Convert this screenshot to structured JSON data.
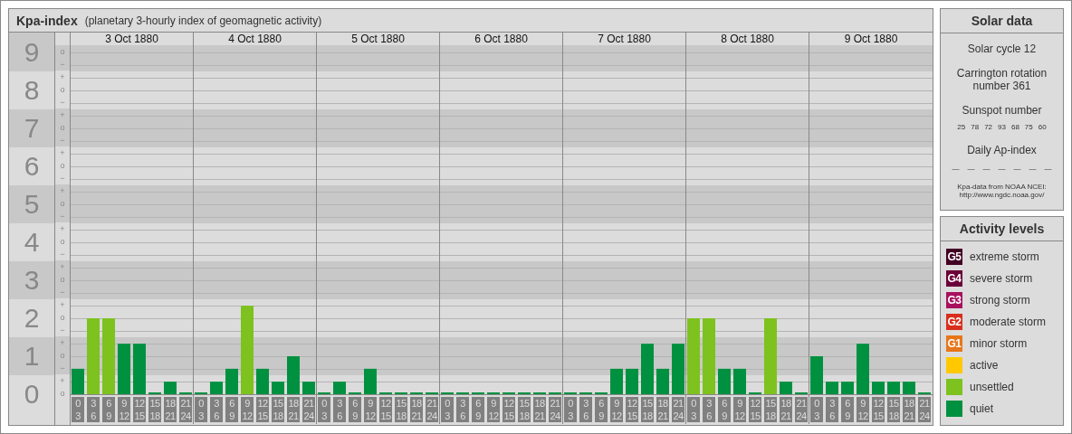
{
  "kpa_panel": {
    "title": "Kpa-index",
    "subtitle": "(planetary 3-hourly index of geomagnetic activity)",
    "y_marks": [
      [
        "o",
        "−"
      ],
      [
        "+",
        "o",
        "−"
      ],
      [
        "+",
        "o",
        "−"
      ],
      [
        "+",
        "o",
        "−"
      ],
      [
        "+",
        "o",
        "−"
      ],
      [
        "+",
        "o",
        "−"
      ],
      [
        "+",
        "o",
        "−"
      ],
      [
        "+",
        "o",
        "−"
      ],
      [
        "+",
        "o",
        "−"
      ],
      [
        "+",
        "o"
      ]
    ],
    "days": [
      {
        "date": "3 Oct 1880",
        "slots": [
          [
            "0",
            "3"
          ],
          [
            "3",
            "6"
          ],
          [
            "6",
            "9"
          ],
          [
            "9",
            "12"
          ],
          [
            "12",
            "15"
          ],
          [
            "15",
            "18"
          ],
          [
            "18",
            "21"
          ],
          [
            "21",
            "24"
          ]
        ]
      },
      {
        "date": "4 Oct 1880",
        "slots": [
          [
            "0",
            "3"
          ],
          [
            "3",
            "6"
          ],
          [
            "6",
            "9"
          ],
          [
            "9",
            "12"
          ],
          [
            "12",
            "15"
          ],
          [
            "15",
            "18"
          ],
          [
            "18",
            "21"
          ],
          [
            "21",
            "24"
          ]
        ]
      },
      {
        "date": "5 Oct 1880",
        "slots": [
          [
            "0",
            "3"
          ],
          [
            "3",
            "6"
          ],
          [
            "6",
            "9"
          ],
          [
            "9",
            "12"
          ],
          [
            "12",
            "15"
          ],
          [
            "15",
            "18"
          ],
          [
            "18",
            "21"
          ],
          [
            "21",
            "24"
          ]
        ]
      },
      {
        "date": "6 Oct 1880",
        "slots": [
          [
            "0",
            "3"
          ],
          [
            "3",
            "6"
          ],
          [
            "6",
            "9"
          ],
          [
            "9",
            "12"
          ],
          [
            "12",
            "15"
          ],
          [
            "15",
            "18"
          ],
          [
            "18",
            "21"
          ],
          [
            "21",
            "24"
          ]
        ]
      },
      {
        "date": "7 Oct 1880",
        "slots": [
          [
            "0",
            "3"
          ],
          [
            "3",
            "6"
          ],
          [
            "6",
            "9"
          ],
          [
            "9",
            "12"
          ],
          [
            "12",
            "15"
          ],
          [
            "15",
            "18"
          ],
          [
            "18",
            "21"
          ],
          [
            "21",
            "24"
          ]
        ]
      },
      {
        "date": "8 Oct 1880",
        "slots": [
          [
            "0",
            "3"
          ],
          [
            "3",
            "6"
          ],
          [
            "6",
            "9"
          ],
          [
            "9",
            "12"
          ],
          [
            "12",
            "15"
          ],
          [
            "15",
            "18"
          ],
          [
            "18",
            "21"
          ],
          [
            "21",
            "24"
          ]
        ]
      },
      {
        "date": "9 Oct 1880",
        "slots": [
          [
            "0",
            "3"
          ],
          [
            "3",
            "6"
          ],
          [
            "6",
            "9"
          ],
          [
            "9",
            "12"
          ],
          [
            "12",
            "15"
          ],
          [
            "15",
            "18"
          ],
          [
            "18",
            "21"
          ],
          [
            "21",
            "24"
          ]
        ]
      }
    ],
    "chart_data": {
      "type": "bar",
      "grid": true,
      "ylim": [
        0,
        9
      ],
      "yticks": [
        {
          "value": 0,
          "label": "0"
        },
        {
          "value": 1,
          "label": "1"
        },
        {
          "value": 2,
          "label": "2"
        },
        {
          "value": 3,
          "label": "3"
        },
        {
          "value": 4,
          "label": "4"
        },
        {
          "value": 5,
          "label": "5"
        },
        {
          "value": 6,
          "label": "6"
        },
        {
          "value": 7,
          "label": "7"
        },
        {
          "value": 8,
          "label": "8"
        },
        {
          "value": 9,
          "label": "9"
        }
      ],
      "series": [
        {
          "color": "#009140",
          "values": [
            0.67,
            null,
            null,
            1.33,
            1.33,
            0,
            0.33,
            0,
            0,
            0.33,
            0.67,
            null,
            0.67,
            0.33,
            1,
            0.33,
            0,
            0.33,
            0,
            0.67,
            0,
            0,
            0,
            0,
            0,
            0,
            0,
            0,
            0,
            0,
            0,
            0,
            0,
            0,
            0,
            0.67,
            0.67,
            1.33,
            0.67,
            1.33,
            null,
            null,
            0.67,
            0.67,
            0,
            null,
            0.33,
            0,
            1,
            0.33,
            0.33,
            1.33,
            0.33,
            0.33,
            0.33,
            0
          ]
        },
        {
          "color": "#7dc21e",
          "values": [
            null,
            2,
            2,
            null,
            null,
            null,
            null,
            null,
            null,
            null,
            null,
            2.33,
            null,
            null,
            null,
            null,
            null,
            null,
            null,
            null,
            null,
            null,
            null,
            null,
            null,
            null,
            null,
            null,
            null,
            null,
            null,
            null,
            null,
            null,
            null,
            null,
            null,
            null,
            null,
            null,
            2,
            2,
            null,
            null,
            null,
            2,
            null,
            null,
            null,
            null,
            null,
            null,
            null,
            null,
            null,
            null
          ]
        }
      ]
    }
  },
  "solar_data": {
    "title": "Solar data",
    "cycle": "Solar cycle 12",
    "rotation": "Carrington rotation number 361",
    "sunspot_title": "Sunspot number",
    "sunspot_numbers": [
      "25",
      "78",
      "72",
      "93",
      "68",
      "75",
      "60"
    ],
    "ap_title": "Daily Ap-index",
    "ap_values": [
      "—",
      "—",
      "—",
      "—",
      "—",
      "—",
      "—"
    ],
    "source": [
      "Kpa-data from NOAA NCEI:",
      "http://www.ngdc.noaa.gov/"
    ]
  },
  "activity_levels": {
    "title": "Activity levels",
    "items": [
      {
        "code": "G5",
        "label": "extreme storm",
        "color": "#420024"
      },
      {
        "code": "G4",
        "label": "severe storm",
        "color": "#6b0038"
      },
      {
        "code": "G3",
        "label": "strong storm",
        "color": "#a8105e"
      },
      {
        "code": "G2",
        "label": "moderate storm",
        "color": "#d92e1c"
      },
      {
        "code": "G1",
        "label": "minor storm",
        "color": "#e8761a"
      },
      {
        "label": "active",
        "color": "#ffc800"
      },
      {
        "label": "unsettled",
        "color": "#7dc21e"
      },
      {
        "label": "quiet",
        "color": "#009140"
      }
    ]
  }
}
